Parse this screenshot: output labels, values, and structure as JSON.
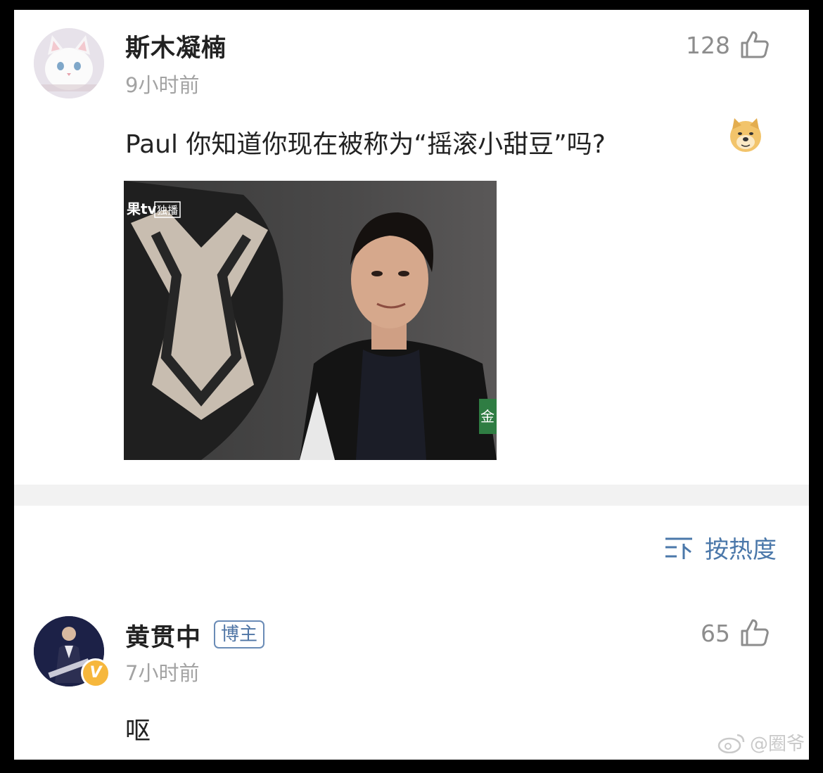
{
  "comments": [
    {
      "username": "斯木凝楠",
      "time": "9小时前",
      "likes": "128",
      "text": "Paul 你知道你现在被称为“摇滚小甜豆”吗?",
      "avatar_icon": "cat-avatar",
      "emoji_icon": "doge-emoji-icon"
    },
    {
      "username": "黄贯中",
      "badge": "博主",
      "time": "7小时前",
      "likes": "65",
      "text": "呕",
      "avatar_icon": "concert-avatar"
    }
  ],
  "media": {
    "channel_logo": "果tv",
    "channel_tag": "独播",
    "corner_text": "金"
  },
  "sort": {
    "label": "按热度"
  },
  "watermark": {
    "text": "@圈爷"
  },
  "colors": {
    "link_blue": "#4b78aa",
    "gray_text": "#a3a3a3",
    "badge_gold": "#f6b73c"
  }
}
